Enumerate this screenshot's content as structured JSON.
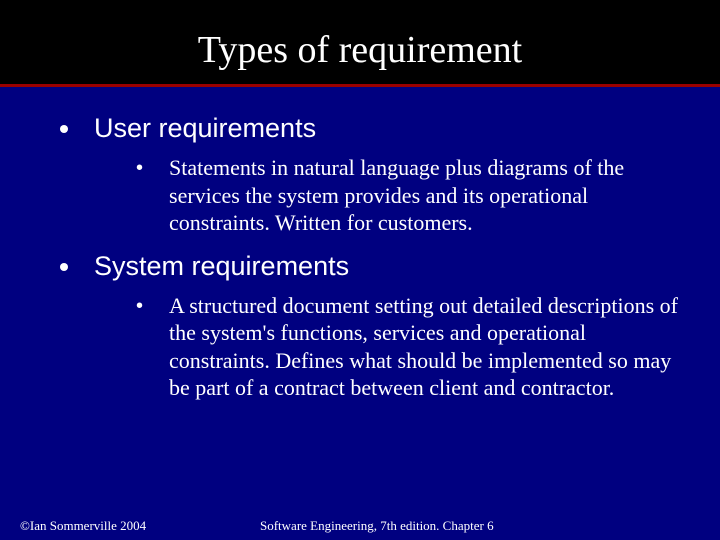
{
  "title": "Types of requirement",
  "items": [
    {
      "label": "User requirements",
      "sub": [
        "Statements in natural language plus diagrams of the services the system provides and its operational constraints. Written for customers."
      ]
    },
    {
      "label": "System requirements",
      "sub": [
        "A structured document setting out detailed descriptions of the system's functions, services and operational constraints. Defines what should be implemented so may be part of a contract between client and contractor."
      ]
    }
  ],
  "footer": {
    "left": "©Ian Sommerville 2004",
    "center": "Software Engineering, 7th edition. Chapter 6"
  }
}
